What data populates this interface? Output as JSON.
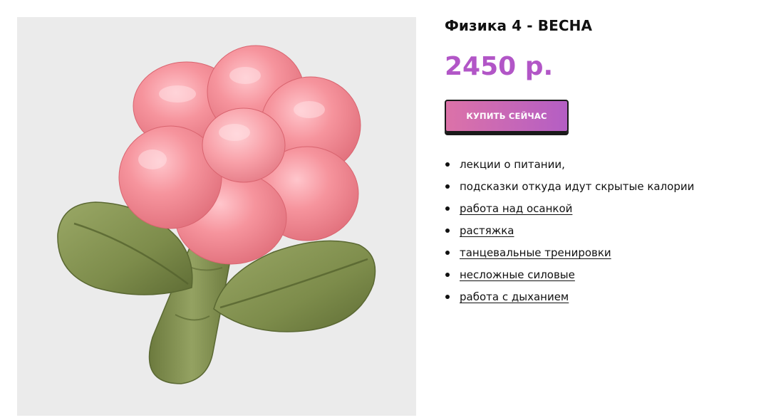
{
  "product": {
    "title": "Физика 4 - ВЕСНА",
    "price": "2450 р.",
    "buy_label": "КУПИТЬ СЕЙЧАС",
    "image_icon": "pink-flower-pillow"
  },
  "features": [
    {
      "text": "лекции о питании,",
      "link": false
    },
    {
      "text": "подсказки откуда идут скрытые калории",
      "link": false
    },
    {
      "text": "работа над осанкой",
      "link": true
    },
    {
      "text": "растяжка",
      "link": true
    },
    {
      "text": "танцевальные тренировки",
      "link": true
    },
    {
      "text": "несложные силовые",
      "link": true
    },
    {
      "text": "работа с дыханием",
      "link": true
    }
  ],
  "colors": {
    "price": "#b256c7",
    "button_gradient_start": "#dc72a8",
    "button_gradient_end": "#b45ec4",
    "image_background": "#ebebeb",
    "petal": "#f08a94",
    "leaf": "#7f8f4e"
  }
}
